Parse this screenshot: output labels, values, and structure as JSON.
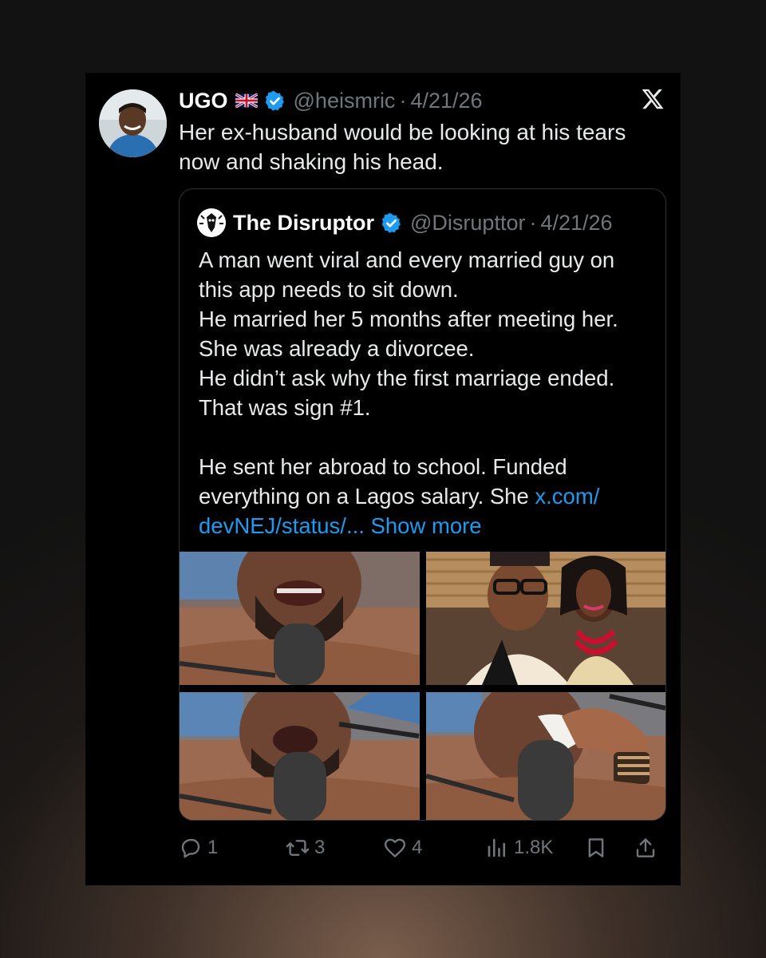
{
  "tweet": {
    "author_name": "UGO",
    "author_flag": "uk-flag-icon",
    "author_handle": "@heismric",
    "separator": "·",
    "date": "4/21/26",
    "text": "Her ex-husband would be looking at his tears now and shaking his head."
  },
  "quoted": {
    "author_name": "The Disruptor",
    "author_handle": "@Disrupttor",
    "separator": "·",
    "date": "4/21/26",
    "lines": [
      "A man went viral and every married guy on this app needs to sit down.",
      "He married her 5 months after meeting her.",
      "She was already a divorcee.",
      "He didn’t ask why the first marriage ended.",
      "That was sign #1."
    ],
    "paragraph2": "He sent her abroad to school. Funded everything on a Lagos salary. She ",
    "link_text": "x.com/ devNEJ/status/...",
    "show_more": " Show more"
  },
  "actions": {
    "replies": "1",
    "reposts": "3",
    "likes": "4",
    "views": "1.8K"
  },
  "colors": {
    "link": "#1d9bf0",
    "verified": "#1d9bf0",
    "muted": "#71767b",
    "text": "#e7e9ea",
    "card_bg": "#000000"
  },
  "icons": {
    "platform": "x-logo-icon",
    "verified": "verified-badge-icon",
    "reply": "reply-icon",
    "repost": "repost-icon",
    "like": "heart-icon",
    "views": "views-icon",
    "bookmark": "bookmark-icon",
    "share": "share-icon"
  }
}
